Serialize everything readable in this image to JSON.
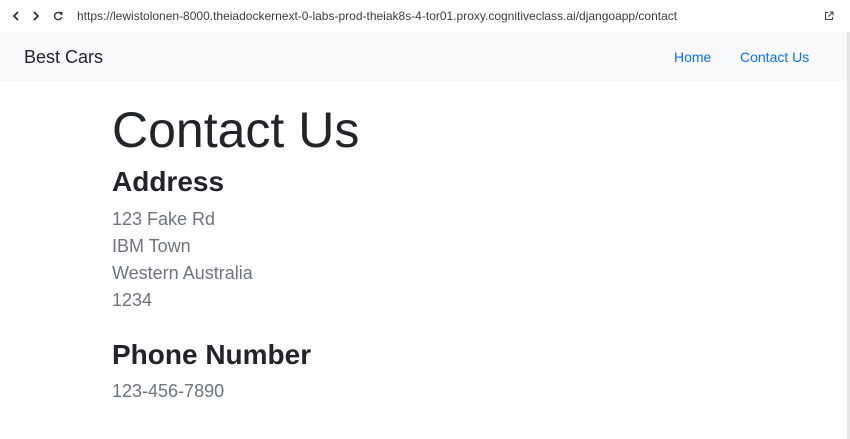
{
  "browser": {
    "url": "https://lewistolonen-8000.theiadockernext-0-labs-prod-theiak8s-4-tor01.proxy.cognitiveclass.ai/djangoapp/contact",
    "icons": {
      "back": "chevron-left-icon",
      "forward": "chevron-right-icon",
      "reload": "reload-icon",
      "open_external": "external-link-icon"
    }
  },
  "navbar": {
    "brand": "Best Cars",
    "links": [
      {
        "label": "Home"
      },
      {
        "label": "Contact Us"
      }
    ]
  },
  "main": {
    "title": "Contact Us",
    "address": {
      "heading": "Address",
      "lines": [
        "123 Fake Rd",
        "IBM Town",
        "Western Australia",
        "1234"
      ]
    },
    "phone": {
      "heading": "Phone Number",
      "value": "123-456-7890"
    }
  },
  "colors": {
    "link": "#0d6efd",
    "navbar_bg": "#f8f9fa",
    "heading": "#212529",
    "muted_text": "#6c757d"
  }
}
